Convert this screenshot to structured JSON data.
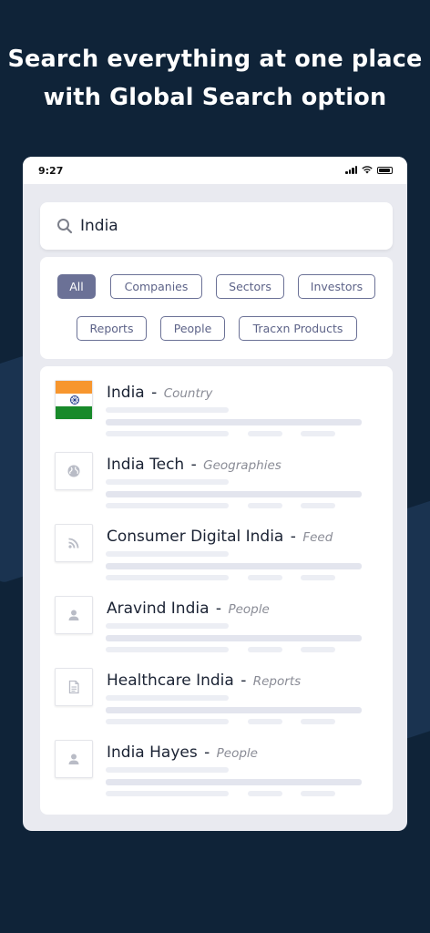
{
  "headline": {
    "line1": "Search everything at one place",
    "line2": "with Global Search option"
  },
  "statusbar": {
    "time": "9:27"
  },
  "search": {
    "value": "India"
  },
  "filters": [
    {
      "label": "All",
      "active": true
    },
    {
      "label": "Companies",
      "active": false
    },
    {
      "label": "Sectors",
      "active": false
    },
    {
      "label": "Investors",
      "active": false
    },
    {
      "label": "Reports",
      "active": false
    },
    {
      "label": "People",
      "active": false
    },
    {
      "label": "Tracxn Products",
      "active": false
    }
  ],
  "results": [
    {
      "name": "India",
      "type": "Country",
      "icon": "india-flag-icon"
    },
    {
      "name": "India Tech",
      "type": "Geographies",
      "icon": "globe-icon"
    },
    {
      "name": "Consumer Digital India",
      "type": "Feed",
      "icon": "rss-feed-icon"
    },
    {
      "name": "Aravind India",
      "type": "People",
      "icon": "person-icon"
    },
    {
      "name": "Healthcare India",
      "type": "Reports",
      "icon": "document-icon"
    },
    {
      "name": "India Hayes",
      "type": "People",
      "icon": "person-icon"
    }
  ],
  "colors": {
    "background": "#0f2338",
    "chip_border": "#6b7196",
    "chip_active_bg": "#6b7196",
    "flag_saffron": "#f7962e",
    "flag_green": "#188a2a",
    "chakra": "#1f3a8a"
  }
}
